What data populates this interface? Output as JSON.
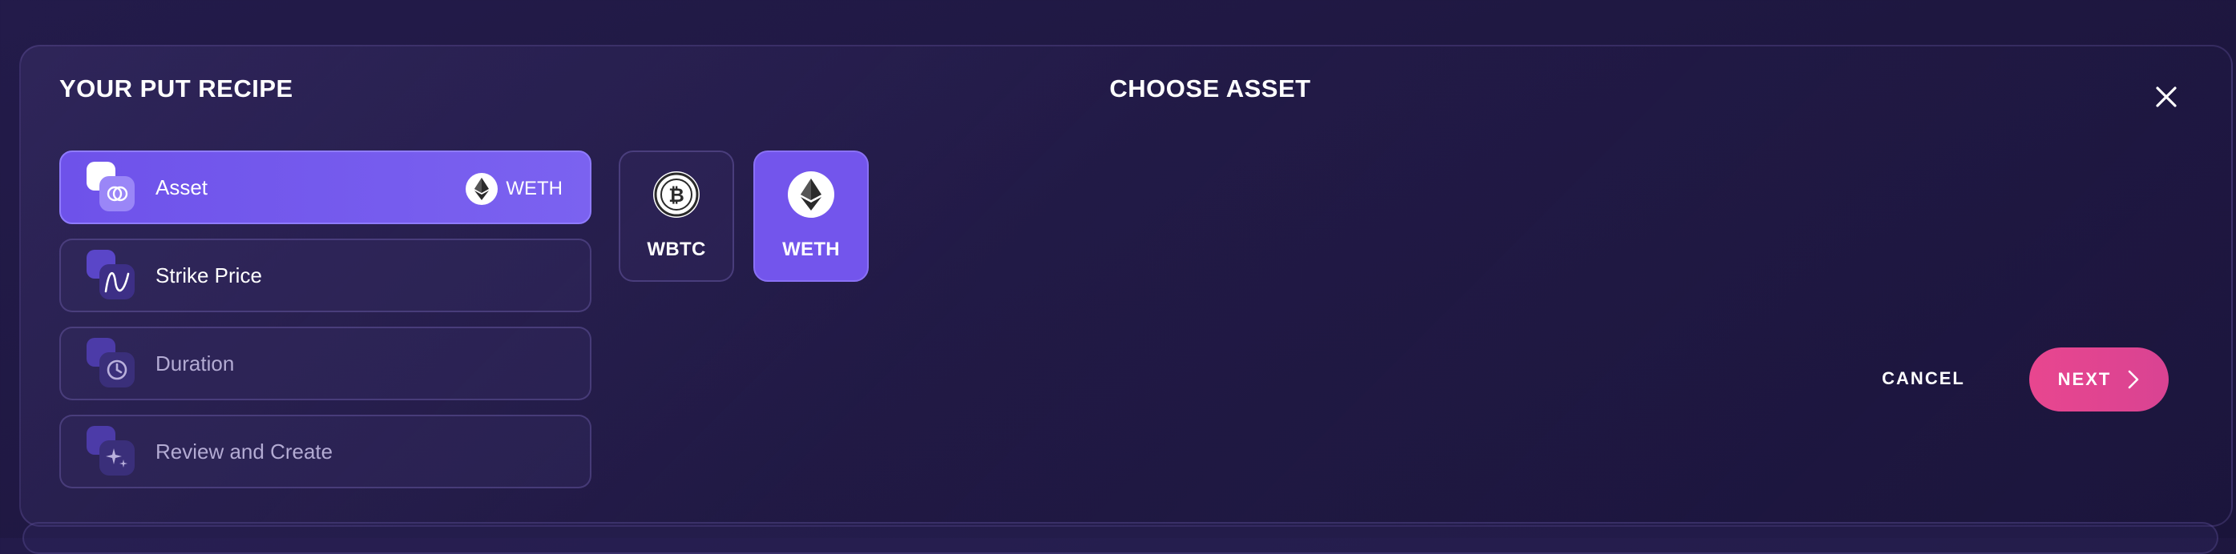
{
  "header": {
    "recipe_title": "YOUR PUT RECIPE",
    "choose_title": "CHOOSE ASSET",
    "close_icon": "close-icon"
  },
  "steps": [
    {
      "label": "Asset",
      "icon": "asset-stack-icon",
      "state": "active",
      "selected_value": "WETH",
      "selected_icon": "ethereum-icon"
    },
    {
      "label": "Strike Price",
      "icon": "strike-curve-icon",
      "state": "enabled"
    },
    {
      "label": "Duration",
      "icon": "clock-icon",
      "state": "disabled"
    },
    {
      "label": "Review and Create",
      "icon": "sparkle-icon",
      "state": "disabled"
    }
  ],
  "assets": [
    {
      "name": "WBTC",
      "icon": "bitcoin-icon",
      "selected": false
    },
    {
      "name": "WETH",
      "icon": "ethereum-icon",
      "selected": true
    }
  ],
  "actions": {
    "cancel_label": "CANCEL",
    "next_label": "NEXT",
    "next_icon": "chevron-right-icon"
  },
  "colors": {
    "background": "#1f1842",
    "accent_purple": "#7355ec",
    "next_pink": "#e8468f",
    "disabled_text": "#b3abd3"
  }
}
